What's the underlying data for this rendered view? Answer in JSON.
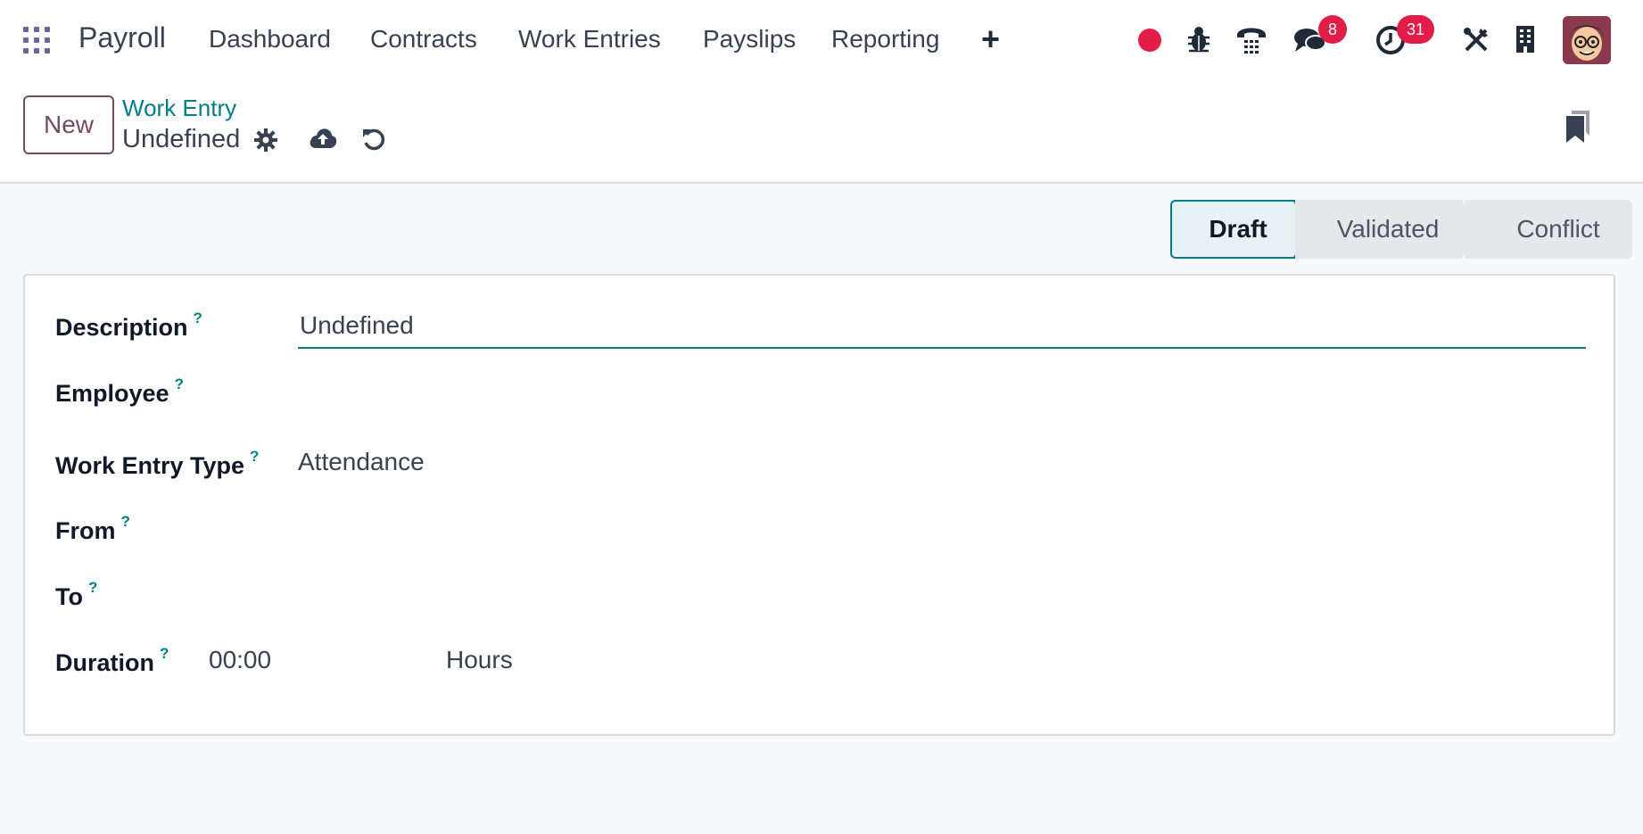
{
  "navbar": {
    "brand": "Payroll",
    "menu": [
      "Dashboard",
      "Contracts",
      "Work Entries",
      "Payslips",
      "Reporting"
    ],
    "messages_count": "8",
    "activities_count": "31"
  },
  "control": {
    "new_label": "New",
    "breadcrumb_parent": "Work Entry",
    "breadcrumb_current": "Undefined"
  },
  "statusbar": {
    "stages": [
      "Draft",
      "Validated",
      "Conflict"
    ],
    "active": "Draft"
  },
  "form": {
    "description_label": "Description",
    "description_value": "Undefined",
    "employee_label": "Employee",
    "work_entry_type_label": "Work Entry Type",
    "work_entry_type_value": "Attendance",
    "from_label": "From",
    "to_label": "To",
    "duration_label": "Duration",
    "duration_value": "00:00",
    "duration_unit": "Hours",
    "help_mark": "?"
  },
  "colors": {
    "accent": "#017e84",
    "primary": "#714b67",
    "badge": "#e11d48"
  }
}
